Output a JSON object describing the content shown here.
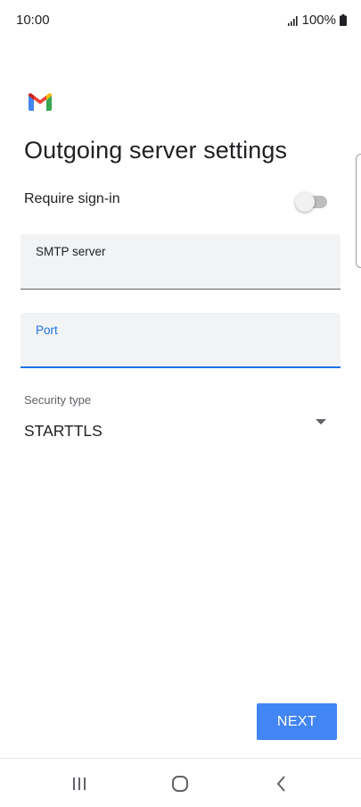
{
  "status_bar": {
    "time": "10:00",
    "battery": "100%",
    "signal_icon": "signal-icon",
    "battery_icon": "battery-icon"
  },
  "app": {
    "logo_icon": "gmail-logo-icon",
    "title": "Outgoing server settings"
  },
  "require_signin": {
    "label": "Require sign-in",
    "enabled": false
  },
  "fields": {
    "smtp": {
      "label": "SMTP server",
      "value": ""
    },
    "port": {
      "label": "Port",
      "value": ""
    }
  },
  "security": {
    "label": "Security type",
    "value": "STARTTLS"
  },
  "actions": {
    "next_label": "NEXT"
  },
  "colors": {
    "accent": "#1a73e8",
    "button": "#4285f4",
    "field_background": "#f1f3f4"
  },
  "nav_bar": {
    "recents_icon": "recents-icon",
    "home_icon": "home-icon",
    "back_icon": "back-icon"
  }
}
